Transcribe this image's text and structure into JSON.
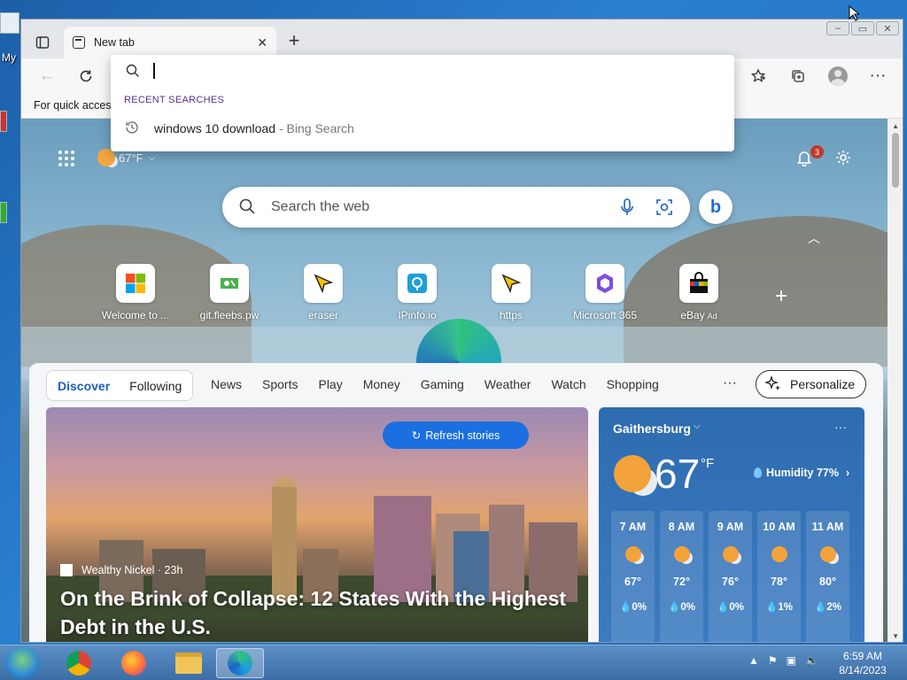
{
  "desktop": {
    "icon_label": "My"
  },
  "browser": {
    "tab": {
      "title": "New tab"
    },
    "favorites_bar_text": "For quick access"
  },
  "omnibox": {
    "value": "",
    "recent_header": "RECENT SEARCHES",
    "recent": [
      {
        "query": "windows 10 download",
        "source": "- Bing Search"
      }
    ]
  },
  "newtab": {
    "weather_mini": "67°F",
    "notifications_count": "3",
    "search_placeholder": "Search the web",
    "tiles": [
      {
        "label": "Welcome to ...",
        "icon": "microsoft-logo-icon"
      },
      {
        "label": "git.fleebs.pw",
        "icon": "git-icon"
      },
      {
        "label": "eraser",
        "icon": "cursor-icon"
      },
      {
        "label": "IPinfo.io",
        "icon": "location-icon"
      },
      {
        "label": "https",
        "icon": "cursor-icon"
      },
      {
        "label": "Microsoft 365",
        "icon": "m365-icon"
      },
      {
        "label": "eBay",
        "ad": "Ad",
        "icon": "ebay-bag-icon"
      }
    ]
  },
  "feed": {
    "nav_pill": [
      "Discover",
      "Following"
    ],
    "categories": [
      "News",
      "Sports",
      "Play",
      "Money",
      "Gaming",
      "Weather",
      "Watch",
      "Shopping"
    ],
    "more": "···",
    "personalize": "Personalize",
    "story": {
      "refresh": "Refresh stories",
      "source": "Wealthy Nickel · 23h",
      "headline": "On the Brink of Collapse: 12 States With the Highest Debt in the U.S."
    },
    "weather": {
      "city": "Gaithersburg",
      "temp": "67",
      "unit": "°F",
      "humidity": "Humidity 77%",
      "hours": [
        {
          "time": "7 AM",
          "temp": "67°",
          "precip": "0%",
          "cloudy": true
        },
        {
          "time": "8 AM",
          "temp": "72°",
          "precip": "0%",
          "cloudy": true
        },
        {
          "time": "9 AM",
          "temp": "76°",
          "precip": "0%",
          "cloudy": true
        },
        {
          "time": "10 AM",
          "temp": "78°",
          "precip": "1%",
          "cloudy": false
        },
        {
          "time": "11 AM",
          "temp": "80°",
          "precip": "2%",
          "cloudy": true
        }
      ]
    }
  },
  "taskbar": {
    "clock_time": "6:59 AM",
    "clock_date": "8/14/2023"
  }
}
